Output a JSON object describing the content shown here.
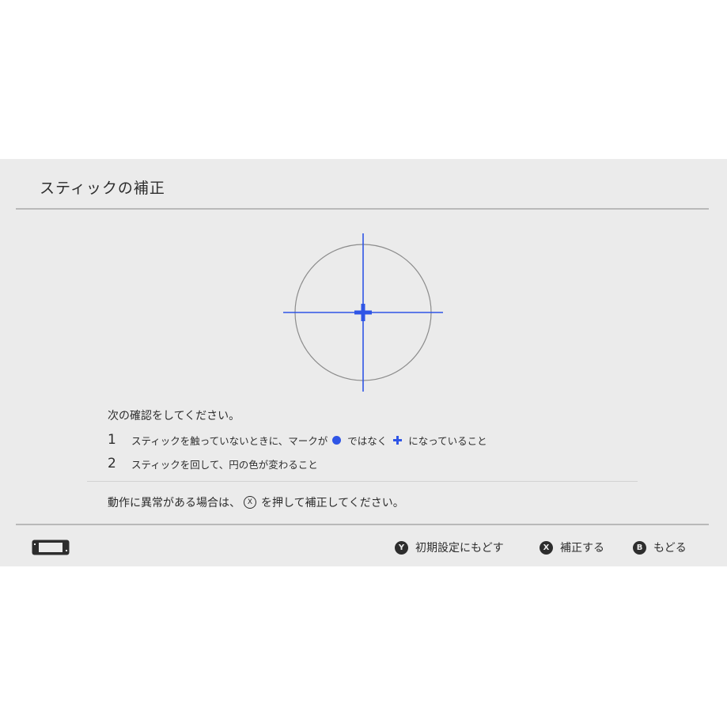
{
  "header": {
    "title": "スティックの補正"
  },
  "instructions": {
    "lead": "次の確認をしてください。",
    "steps": [
      {
        "number": "1",
        "text_before": "スティックを触っていないときに、マークが",
        "text_middle": "ではなく",
        "text_after": "になっていること"
      },
      {
        "number": "2",
        "text": "スティックを回して、円の色が変わること"
      }
    ],
    "note_before": "動作に異常がある場合は、",
    "note_button": "X",
    "note_after": "を押して補正してください。"
  },
  "footer": {
    "console_icon": "switch-console-icon",
    "buttons": [
      {
        "badge": "Y",
        "label": "初期設定にもどす"
      },
      {
        "badge": "X",
        "label": "補正する"
      },
      {
        "badge": "B",
        "label": "もどる"
      }
    ]
  },
  "colors": {
    "accent_blue": "#2f55e6",
    "background": "#ebebeb",
    "text": "#2d2d2d",
    "circle": "#8c8c8c"
  }
}
